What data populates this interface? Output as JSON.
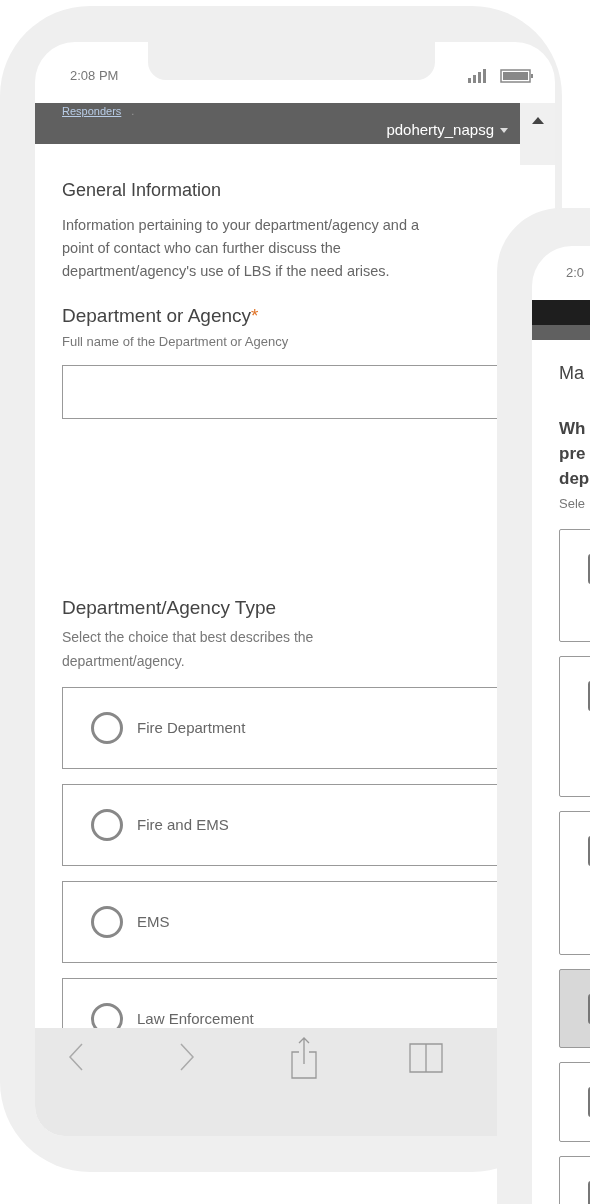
{
  "phone_left": {
    "status_bar": {
      "time": "2:08 PM"
    },
    "header": {
      "link": "Responders",
      "punctuation": ".",
      "user": "pdoherty_napsg"
    },
    "section": {
      "title": "General Information",
      "description": "Information pertaining to your department/agency and a point of contact who can further discuss the department/agency's use of LBS if the need arises."
    },
    "fields": [
      {
        "label": "Department or Agency",
        "required_mark": "*",
        "hint": "Full name of the Department or Agency"
      }
    ],
    "choice": {
      "label": "Department/Agency Type",
      "hint": "Select the choice that best describes the department/agency.",
      "options": [
        {
          "label": "Fire Department",
          "selected": false
        },
        {
          "label": "Fire and EMS",
          "selected": false
        },
        {
          "label": "EMS",
          "selected": false
        },
        {
          "label": "Law Enforcement",
          "selected": false
        }
      ]
    }
  },
  "phone_right": {
    "status_bar": {
      "time": "2:0"
    },
    "section_title": "Ma",
    "question_lines": [
      "Wh",
      "pre",
      "dep"
    ],
    "hint": "Sele",
    "options": [
      {
        "highlighted": false
      },
      {
        "highlighted": false
      },
      {
        "highlighted": false
      },
      {
        "highlighted": true
      },
      {
        "highlighted": false
      },
      {
        "highlighted": false
      }
    ]
  }
}
